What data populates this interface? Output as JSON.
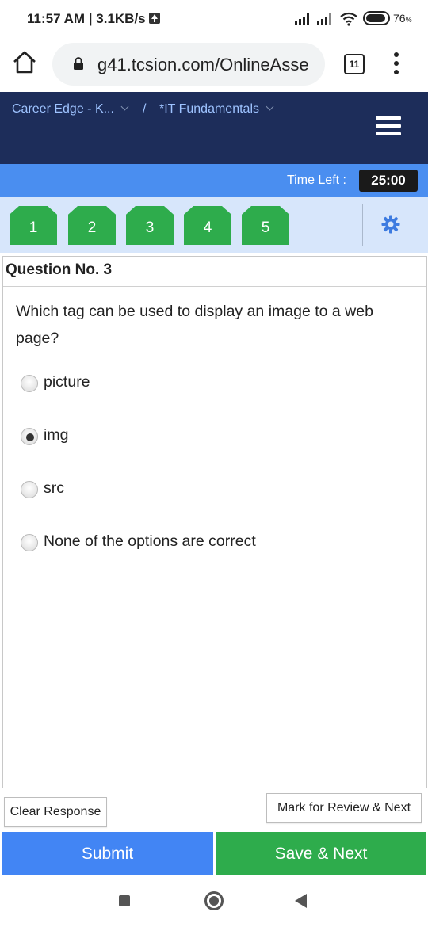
{
  "status_bar": {
    "time": "11:57 AM | 3.1KB/s",
    "battery": "76",
    "battery_unit": "%"
  },
  "browser": {
    "url": "g41.tcsion.com/OnlineAsse",
    "tab_count": "11"
  },
  "header": {
    "breadcrumb_1": "Career Edge - K...",
    "breadcrumb_separator": "/",
    "breadcrumb_2": "*IT Fundamentals"
  },
  "timer": {
    "label": "Time Left :",
    "value": "25:00"
  },
  "palette": {
    "buttons": [
      "1",
      "2",
      "3",
      "4",
      "5"
    ],
    "answered_color": "#2eac4c"
  },
  "question": {
    "title": "Question No. 3",
    "text": "Which tag can be used to display an image to a web page?",
    "options": [
      {
        "label": "picture",
        "selected": false
      },
      {
        "label": "img",
        "selected": true
      },
      {
        "label": "src",
        "selected": false
      },
      {
        "label": "None of the options are correct",
        "selected": false
      }
    ]
  },
  "actions": {
    "clear_label": "Clear Response",
    "review_label": "Mark for Review & Next",
    "submit_label": "Submit",
    "save_label": "Save & Next"
  },
  "colors": {
    "header_bg": "#1d2d5a",
    "timer_bg": "#4a8ef0",
    "palette_bg": "#d7e6fb",
    "submit_bg": "#4285f4",
    "save_bg": "#2eac4c"
  }
}
